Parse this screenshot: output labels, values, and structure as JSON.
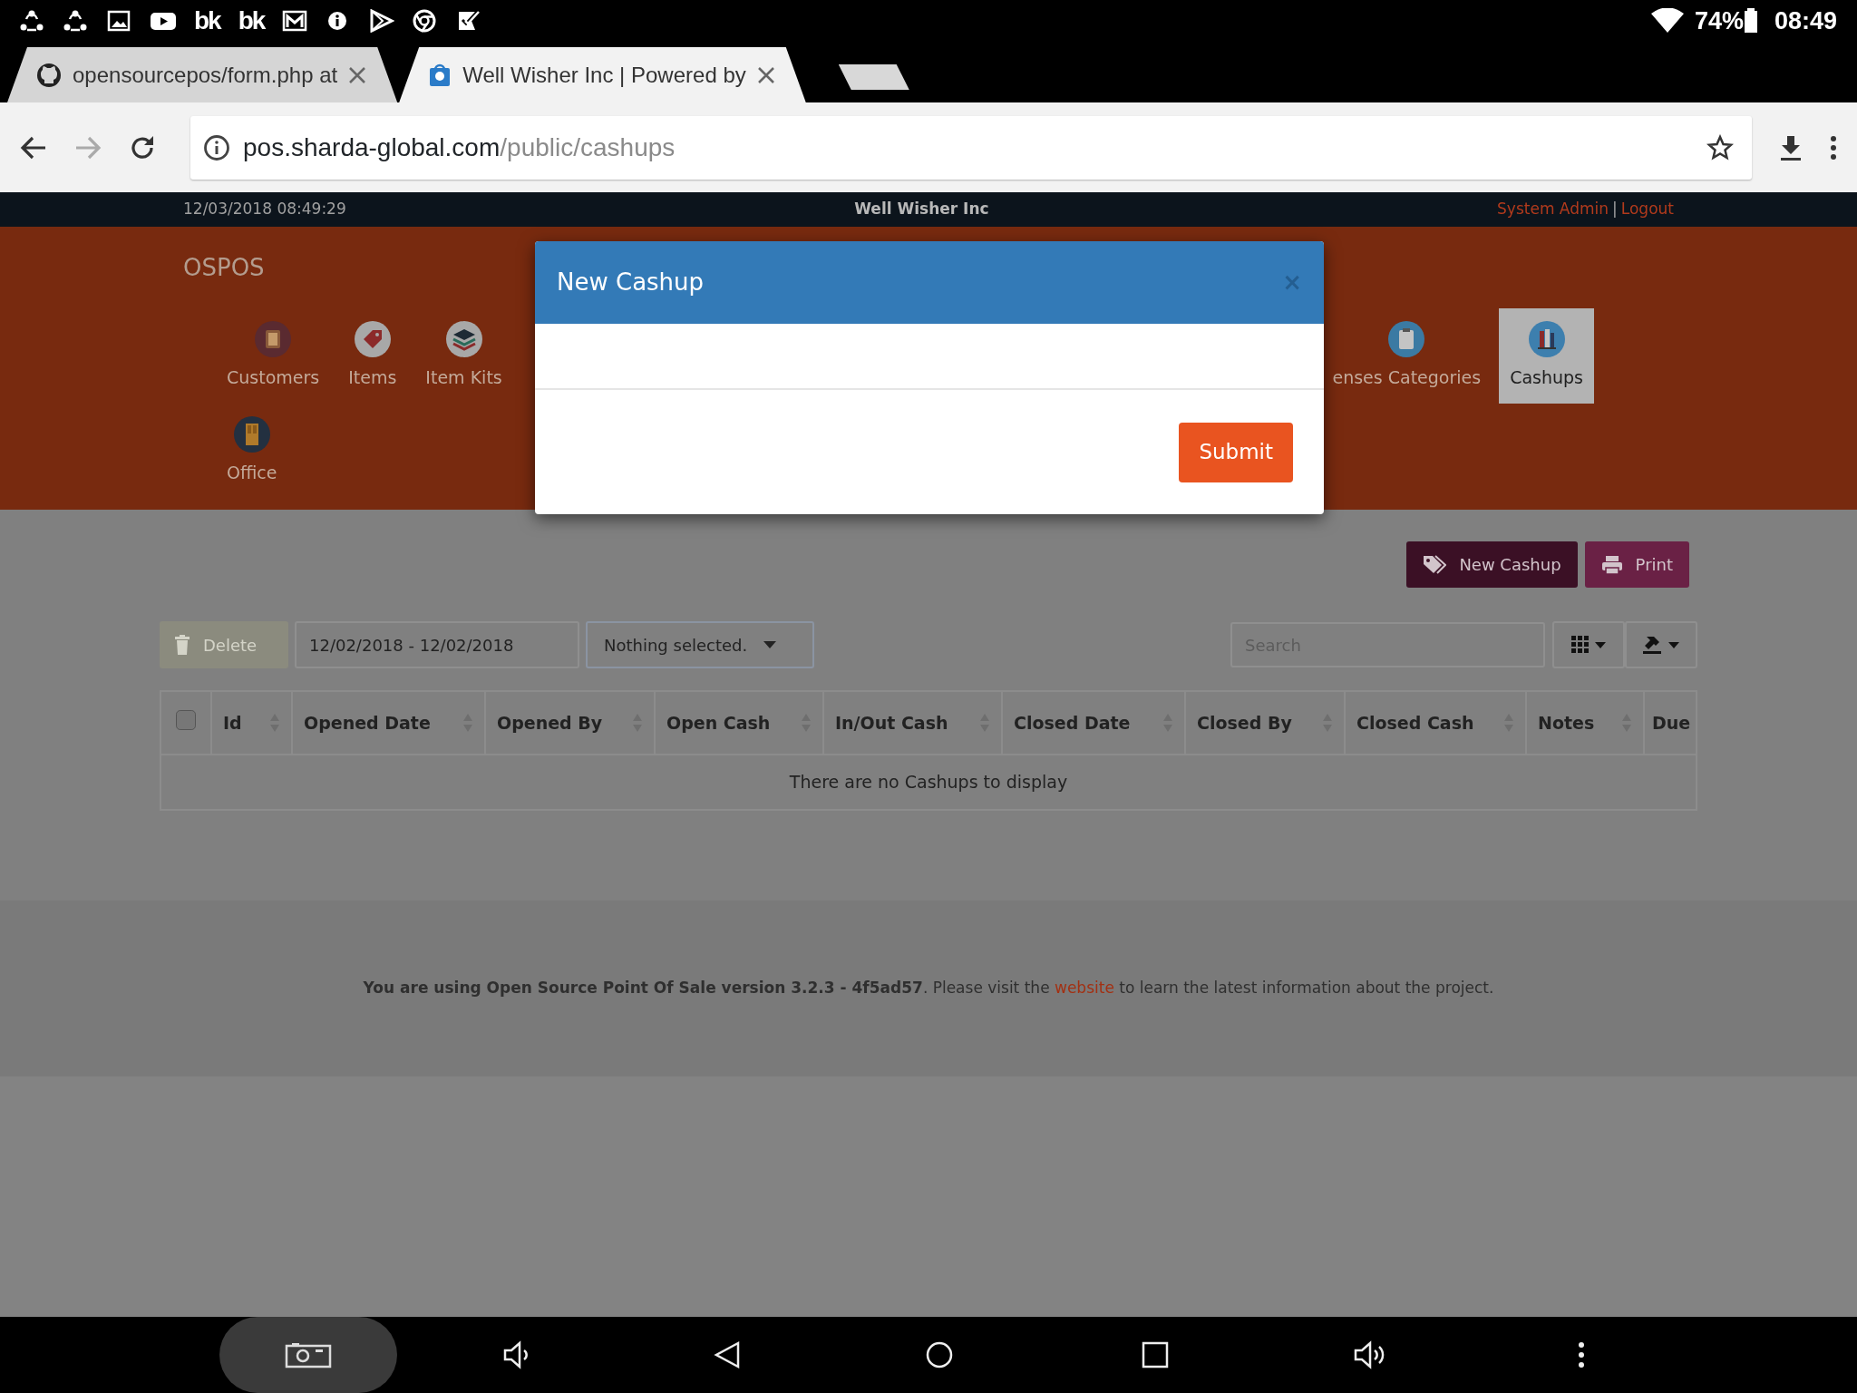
{
  "status_bar": {
    "notifications": [
      {
        "kind": "sync"
      },
      {
        "kind": "sync"
      },
      {
        "kind": "image"
      },
      {
        "kind": "video"
      },
      {
        "kind": "text",
        "text": "bk"
      },
      {
        "kind": "text",
        "text": "bk"
      },
      {
        "kind": "mail"
      },
      {
        "kind": "info"
      },
      {
        "kind": "store"
      },
      {
        "kind": "browser"
      },
      {
        "kind": "task"
      }
    ],
    "battery": "74%",
    "time": "08:49"
  },
  "browser": {
    "tabs": [
      {
        "title": "opensourcepos/form.php at",
        "selected": false
      },
      {
        "title": "Well Wisher Inc | Powered by",
        "selected": true
      }
    ],
    "url": {
      "host": "pos.sharda-global.com",
      "path": "/public/cashups"
    }
  },
  "topbar": {
    "datetime": "12/03/2018 08:49:29",
    "company": "Well Wisher Inc",
    "user": "System Admin",
    "separator": "|",
    "logout": "Logout"
  },
  "header": {
    "brand": "OSPOS",
    "row_1_start": [
      {
        "label": "Customers",
        "kind": "customers",
        "selected": false
      },
      {
        "label": "Items",
        "kind": "items",
        "selected": false
      },
      {
        "label": "Item Kits",
        "kind": "kits",
        "selected": false
      }
    ],
    "row_1_end": [
      {
        "label": "enses Categories",
        "kind": "expenses",
        "selected": false
      },
      {
        "label": "Cashups",
        "kind": "cashups",
        "selected": true
      }
    ],
    "row_2": [
      {
        "label": "Office",
        "kind": "office",
        "selected": false
      }
    ]
  },
  "toolbar": {
    "new_button": "New Cashup",
    "print_button": "Print",
    "delete_button": {
      "label": "Delete",
      "disabled": true
    },
    "date_range": "12/02/2018 - 12/02/2018",
    "filter": "Nothing selected.",
    "search_placeholder": "Search"
  },
  "table": {
    "select_all_checked": false,
    "columns": [
      "Id",
      "Opened Date",
      "Opened By",
      "Open Cash",
      "In/Out Cash",
      "Closed Date",
      "Closed By",
      "Closed Cash",
      "Notes",
      "Due"
    ],
    "empty_message": "There are no Cashups to display"
  },
  "footer": {
    "text": "**You are using Open Source Point Of Sale version 3.2.3 - 4f5ad57**. Please visit the",
    "link": "website",
    "text_after": "to learn the latest information about the project."
  },
  "modal": {
    "title": "New Cashup",
    "close": "×",
    "submit": "Submit"
  }
}
